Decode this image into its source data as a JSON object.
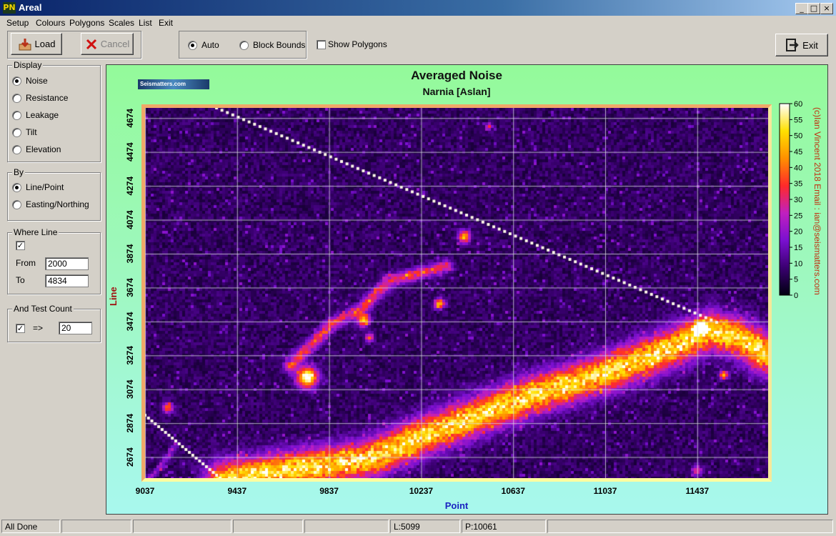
{
  "window": {
    "logo_text": "PN",
    "title": "Areal",
    "min": "_",
    "max": "□",
    "close": "×"
  },
  "menu": [
    "Setup",
    "Colours",
    "Polygons",
    "Scales",
    "List",
    "Exit"
  ],
  "toolbar": {
    "load_label": "Load",
    "cancel_label": "Cancel",
    "mode_auto": "Auto",
    "mode_block": "Block Bounds",
    "show_polygons": "Show Polygons",
    "exit_label": "Exit"
  },
  "display": {
    "label": "Display",
    "options": [
      "Noise",
      "Resistance",
      "Leakage",
      "Tilt",
      "Elevation"
    ],
    "selected": 0
  },
  "by": {
    "label": "By",
    "options": [
      "Line/Point",
      "Easting/Northing"
    ],
    "selected": 0
  },
  "where_line": {
    "label": "Where Line",
    "checked": true,
    "from_label": "From",
    "from_value": "2000",
    "to_label": "To",
    "to_value": "4834"
  },
  "test_count": {
    "label": "And Test Count",
    "checked": true,
    "op": "=>",
    "value": "20"
  },
  "plot": {
    "title": "Averaged Noise",
    "subtitle": "Narnia [Aslan]",
    "watermark": "Seismatters.com",
    "credit": "(c)Ian Vincent 2018  Email : ian@seismatters.com",
    "xlabel": "Point",
    "ylabel": "Line"
  },
  "chart_data": {
    "type": "heatmap",
    "title": "Averaged Noise",
    "subtitle": "Narnia [Aslan]",
    "xlabel": "Point",
    "ylabel": "Line",
    "x_ticks": [
      9037,
      9437,
      9837,
      10237,
      10637,
      11037,
      11437
    ],
    "y_ticks": [
      2674,
      2874,
      3074,
      3274,
      3474,
      3674,
      3874,
      4074,
      4274,
      4474,
      4674
    ],
    "xlim": [
      9037,
      11745
    ],
    "ylim": [
      2550,
      4734
    ],
    "colorbar": {
      "min": 0,
      "max": 60,
      "ticks": [
        0,
        5,
        10,
        15,
        20,
        25,
        30,
        35,
        40,
        45,
        50,
        55,
        60
      ]
    },
    "colors": [
      "#000010",
      "#3a0070",
      "#7a10d0",
      "#c020c0",
      "#ff2a2a",
      "#ff9000",
      "#ffe000",
      "#ffffff"
    ],
    "grid": true
  },
  "status": {
    "message": "All Done",
    "line": "L:5099",
    "point": "P:10061"
  }
}
